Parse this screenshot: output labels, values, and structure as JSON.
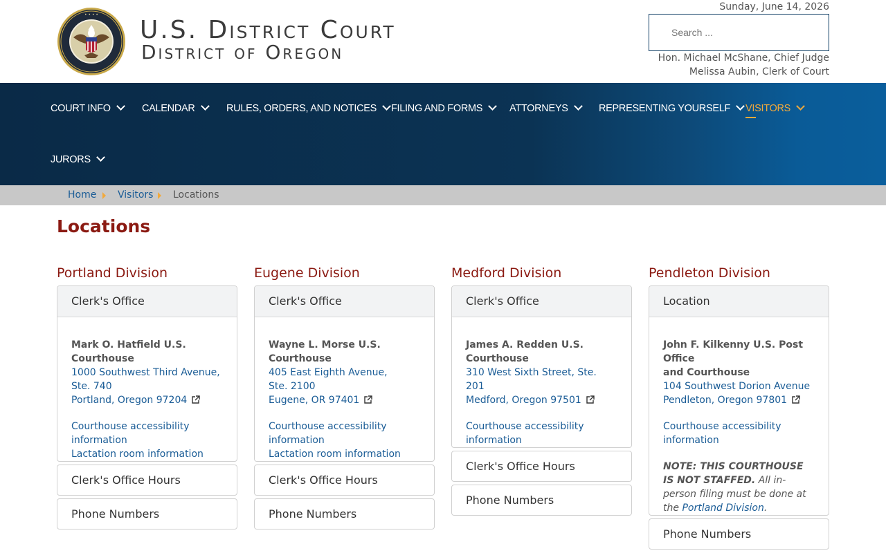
{
  "header": {
    "title_main": "U.S. District Court",
    "title_sub": "District of Oregon",
    "date": "Sunday, June 14, 2026",
    "search_placeholder": "Search ...",
    "chief_judge": "Hon. Michael McShane, Chief Judge",
    "clerk": "Melissa Aubin, Clerk of Court"
  },
  "nav": {
    "items": [
      {
        "label": "COURT INFO"
      },
      {
        "label": "CALENDAR"
      },
      {
        "label": "RULES, ORDERS, AND NOTICES"
      },
      {
        "label": "FILING AND FORMS"
      },
      {
        "label": "ATTORNEYS"
      },
      {
        "label": "REPRESENTING YOURSELF"
      },
      {
        "label": "VISITORS"
      },
      {
        "label": "JURORS"
      }
    ],
    "active": "VISITORS"
  },
  "breadcrumb": {
    "home": "Home",
    "visitors": "Visitors",
    "current": "Locations"
  },
  "page_title": "Locations",
  "colors": {
    "nav_dark": "#0a2a47",
    "nav_light": "#0a5e9c",
    "accent": "#f2a93b",
    "heading": "#8b1a12",
    "link": "#1a5c96"
  },
  "divisions": [
    {
      "title": "Portland Division",
      "card_header": "Clerk's Office",
      "building": "Mark O. Hatfield U.S. Courthouse",
      "address_lines": [
        "1000 Southwest Third Avenue,",
        "Ste. 740",
        "Portland, Oregon 97204"
      ],
      "links": [
        "Courthouse accessibility information",
        "Lactation room information"
      ],
      "accordions": [
        "Clerk's Office Hours",
        "Phone Numbers"
      ]
    },
    {
      "title": "Eugene Division",
      "card_header": "Clerk's Office",
      "building": "Wayne L. Morse U.S. Courthouse",
      "address_lines": [
        "405 East Eighth Avenue,",
        "Ste. 2100",
        "Eugene, OR 97401"
      ],
      "links": [
        "Courthouse accessibility information",
        "Lactation room information"
      ],
      "accordions": [
        "Clerk's Office Hours",
        "Phone Numbers"
      ]
    },
    {
      "title": "Medford Division",
      "card_header": "Clerk's Office",
      "building": "James A. Redden U.S. Courthouse",
      "address_lines": [
        "310 West Sixth Street, Ste. 201",
        "Medford, Oregon 97501"
      ],
      "links": [
        "Courthouse accessibility information"
      ],
      "accordions": [
        "Clerk's Office Hours",
        "Phone Numbers"
      ]
    },
    {
      "title": "Pendleton Division",
      "card_header": "Location",
      "building_lines": [
        "John F. Kilkenny U.S. Post Office",
        "and Courthouse"
      ],
      "address_lines": [
        "104 Southwest Dorion Avenue",
        "Pendleton, Oregon 97801"
      ],
      "links": [
        "Courthouse accessibility information"
      ],
      "note_bold": "NOTE: THIS COURTHOUSE IS NOT STAFFED.",
      "note_text": " All in-person filing must be done at the ",
      "note_link": "Portland Division",
      "note_end": ".",
      "accordions": [
        "Phone Numbers"
      ]
    }
  ]
}
